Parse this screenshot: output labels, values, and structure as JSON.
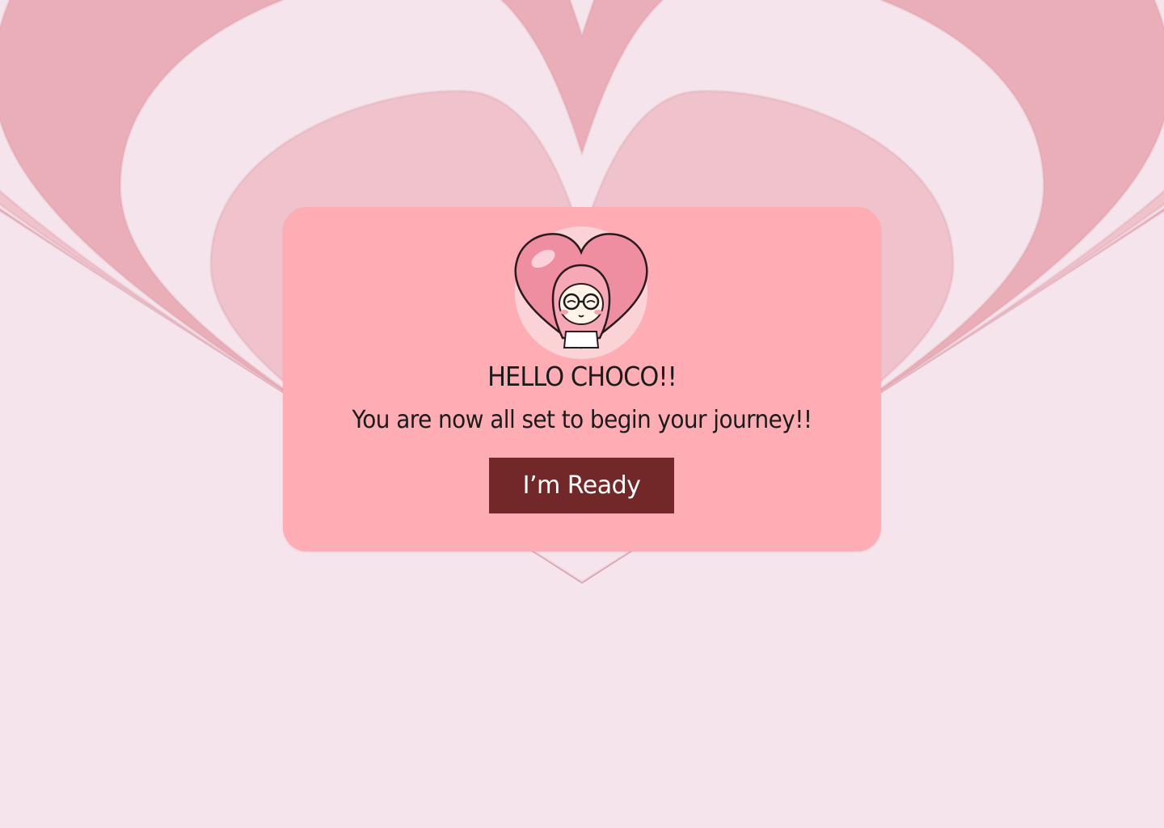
{
  "dialog": {
    "title": "HELLO CHOCO!!",
    "message": "You are now all set to begin your journey!!",
    "button_label": "I’m Ready"
  },
  "icons": {
    "avatar": "heart-girl-avatar-icon"
  },
  "colors": {
    "background_light": "#f6e4ec",
    "background_ring_mid": "#efc2cc",
    "background_ring_dark": "#e9aeb8",
    "card": "#ffadb4",
    "button": "#722728",
    "button_text": "#ffffff",
    "text": "#1b1b1b"
  }
}
